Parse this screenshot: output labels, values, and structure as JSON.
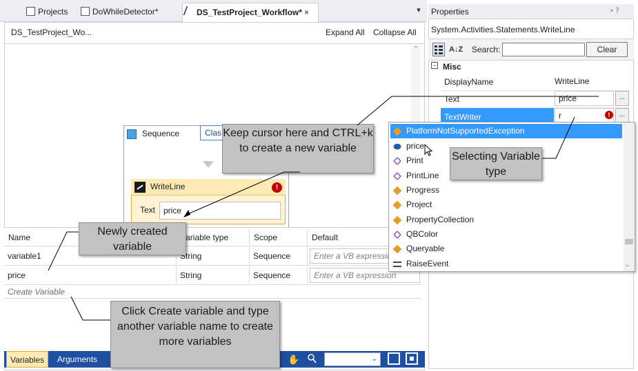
{
  "tabs": [
    {
      "label": "Projects",
      "active": false
    },
    {
      "label": "DoWhileDetector*",
      "active": false
    },
    {
      "label": "DS_TestProject_Workflow*",
      "active": true
    }
  ],
  "tab_close": "×",
  "tab_dropdown": "▾",
  "designer": {
    "breadcrumb": "DS_TestProject_Wo...",
    "expand_all": "Expand All",
    "collapse_all": "Collapse All",
    "sequence_label": "Sequence",
    "clas_label": "Clas",
    "writeline_title": "WriteLine",
    "writeline_text_label": "Text",
    "writeline_text_value": "price"
  },
  "variables": {
    "headers": [
      "Name",
      "Variable type",
      "Scope",
      "Default"
    ],
    "rows": [
      {
        "name": "variable1",
        "type": "String",
        "scope": "Sequence",
        "default": "Enter a VB expression"
      },
      {
        "name": "price",
        "type": "String",
        "scope": "Sequence",
        "default": "Enter a VB expression"
      }
    ],
    "create_label": "Create Variable"
  },
  "bottom_tabs": {
    "variables": "Variables",
    "arguments": "Arguments",
    "zoom_dd": "⌄"
  },
  "properties": {
    "title": "Properties",
    "pin": "▾ ᚹ",
    "type_name": "System.Activities.Statements.WriteLine",
    "search_label": "Search:",
    "clear_label": "Clear",
    "az_label": "A↓Z",
    "category": "Misc",
    "rows": [
      {
        "name": "DisplayName",
        "value": "WriteLine"
      },
      {
        "name": "Text",
        "value": "price"
      },
      {
        "name": "TextWriter",
        "value": "r"
      }
    ],
    "ellipsis": "..."
  },
  "intellisense": [
    {
      "label": "PlatformNotSupportedException",
      "icon": "class-icon"
    },
    {
      "label": "price",
      "icon": "variable-icon"
    },
    {
      "label": "Print",
      "icon": "method-icon"
    },
    {
      "label": "PrintLine",
      "icon": "method-icon"
    },
    {
      "label": "Progress",
      "icon": "class-icon"
    },
    {
      "label": "Project",
      "icon": "class-icon"
    },
    {
      "label": "PropertyCollection",
      "icon": "class-icon"
    },
    {
      "label": "QBColor",
      "icon": "method-icon"
    },
    {
      "label": "Queryable",
      "icon": "class-icon"
    },
    {
      "label": "RaiseEvent",
      "icon": "event-icon"
    }
  ],
  "callouts": {
    "cursor": "Keep cursor here and CTRL+k to create a new variable",
    "selecting": "Selecting Variable type",
    "newly": "Newly created variable",
    "create_more": "Click Create variable and type another variable name to create more variables"
  },
  "icons": {
    "scroll_up": "⌃",
    "scroll_down": "⌄",
    "misc_toggle": "−",
    "error": "!",
    "hand": "✋",
    "magnifier": "🔍"
  },
  "colors": {
    "accent": "#3399ff",
    "bottom_bar": "#1e4fa1",
    "callout": "#c2c2c2",
    "writeline_header": "#fde9b4",
    "error": "#c00000"
  }
}
